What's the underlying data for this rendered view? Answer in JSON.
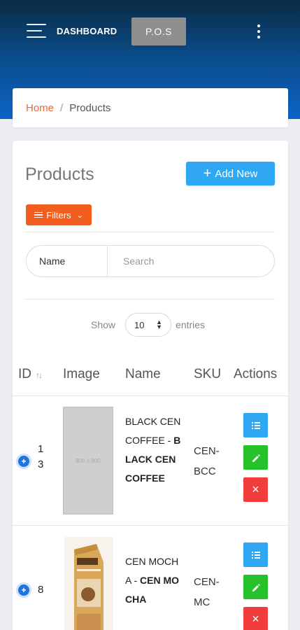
{
  "header": {
    "dashboard_label": "DASHBOARD",
    "pos_label": "P.O.S"
  },
  "breadcrumb": {
    "home": "Home",
    "separator": "/",
    "current": "Products"
  },
  "page": {
    "title": "Products",
    "add_label": "Add New",
    "filters_label": "Filters"
  },
  "search": {
    "label": "Name",
    "placeholder": "Search"
  },
  "entries": {
    "show": "Show",
    "value": "10",
    "suffix": "entries"
  },
  "table": {
    "headers": [
      "ID",
      "Image",
      "Name",
      "SKU",
      "Actions"
    ],
    "rows": [
      {
        "id": "13",
        "name_plain": "BLACK CEN COFFEE",
        "name_bold": "BLACK CEN COFFEE",
        "sku": "CEN-BCC",
        "image_text": "800 x 800"
      },
      {
        "id": "8",
        "name_plain": "CEN MOCHA",
        "name_bold": "CEN MOCHA",
        "sku": "CEN-MC",
        "image_text": ""
      }
    ]
  },
  "colors": {
    "accent_blue": "#2fa7f2",
    "accent_orange": "#f25d20",
    "success_green": "#27c12b",
    "danger_red": "#f23b3b"
  }
}
